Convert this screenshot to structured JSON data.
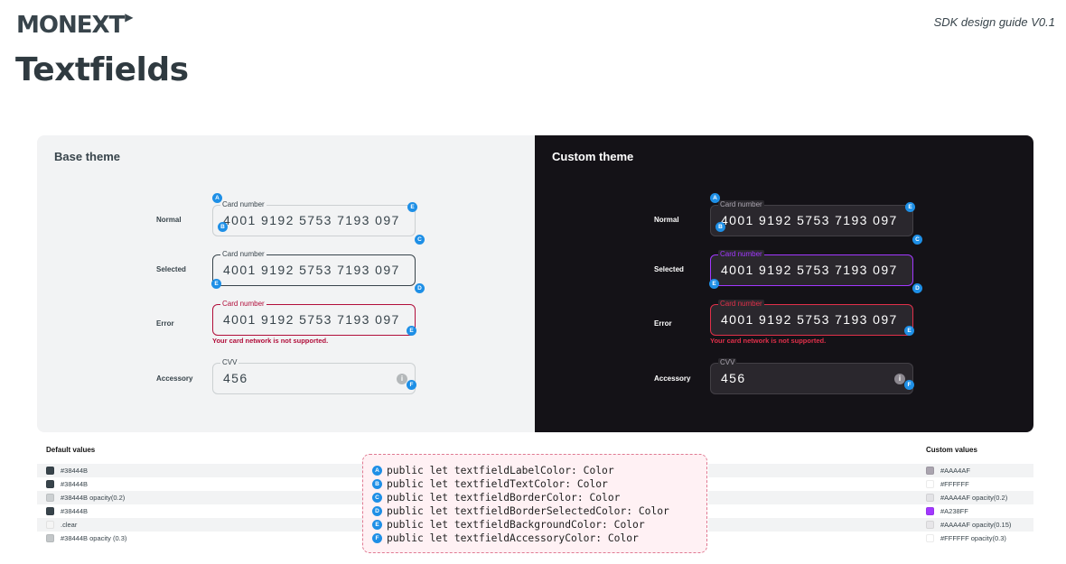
{
  "header": {
    "brand": "MONEXT",
    "guide_version": "SDK design guide V0.1",
    "title": "Textfields"
  },
  "base_theme": {
    "title": "Base theme",
    "states": {
      "normal": "Normal",
      "selected": "Selected",
      "error": "Error",
      "accessory": "Accessory"
    },
    "card_label": "Card number",
    "card_value": "4001 9192 5753 7193 097",
    "cvv_label": "CVV",
    "cvv_value": "456",
    "error_message": "Your card network is not supported.",
    "accessory_icon": "i"
  },
  "custom_theme": {
    "title": "Custom theme",
    "states": {
      "normal": "Normal",
      "selected": "Selected",
      "error": "Error",
      "accessory": "Accessory"
    },
    "card_label": "Card number",
    "card_value": "4001 9192 5753 7193 097",
    "cvv_label": "CVV",
    "cvv_value": "456",
    "error_message": "Your card network is not supported.",
    "accessory_icon": "i"
  },
  "markers": {
    "a": "A",
    "b": "B",
    "c": "C",
    "d": "D",
    "e": "E",
    "f": "F"
  },
  "default_values": {
    "title": "Default values",
    "items": [
      {
        "text": "#38444B",
        "color": "#38444B"
      },
      {
        "text": "#38444B",
        "color": "#38444B"
      },
      {
        "text": "#38444B opacity(0.2)",
        "color": "rgba(56,68,75,0.2)"
      },
      {
        "text": "#38444B",
        "color": "#38444B"
      },
      {
        "text": ".clear",
        "color": "#F5F5F5"
      },
      {
        "text": "#38444B opacity (0.3)",
        "color": "rgba(56,68,75,0.3)"
      }
    ]
  },
  "custom_values": {
    "title": "Custom values",
    "items": [
      {
        "text": "#AAA4AF",
        "color": "#AAA4AF"
      },
      {
        "text": "#FFFFFF",
        "color": "#FFFFFF"
      },
      {
        "text": "#AAA4AF opacity(0.2)",
        "color": "rgba(170,164,175,0.2)"
      },
      {
        "text": "#A238FF",
        "color": "#A238FF"
      },
      {
        "text": "#AAA4AF opacity(0.15)",
        "color": "rgba(170,164,175,0.15)"
      },
      {
        "text": "#FFFFFF opacity(0.3)",
        "color": "rgba(255,255,255,0.3)"
      }
    ]
  },
  "code": {
    "lines": [
      {
        "marker": "A",
        "text": "public let textfieldLabelColor: Color"
      },
      {
        "marker": "B",
        "text": "public let textfieldTextColor: Color"
      },
      {
        "marker": "C",
        "text": "public let textfieldBorderColor: Color"
      },
      {
        "marker": "D",
        "text": "public let textfieldBorderSelectedColor: Color"
      },
      {
        "marker": "E",
        "text": "public let textfieldBackgroundColor: Color"
      },
      {
        "marker": "F",
        "text": "public let textfieldAccessoryColor: Color"
      }
    ]
  },
  "colors": {
    "marker_blue": "#1E8FE6",
    "primary_text": "#38444B",
    "error_red": "#B10E3A",
    "custom_selected": "#A238FF",
    "dark_panel": "#141217"
  }
}
